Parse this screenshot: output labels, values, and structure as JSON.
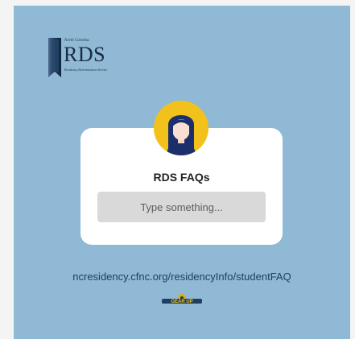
{
  "colors": {
    "background": "#8fb9d4",
    "card": "#ffffff",
    "input": "#d9d9d9",
    "avatar_circle": "#f2c11b",
    "url_text": "#1f3f61"
  },
  "logo": {
    "state": "North Carolina",
    "acronym": "RDS",
    "full_name": "Residency Determination Service"
  },
  "card": {
    "title": "RDS FAQs",
    "input_placeholder": "Type something...",
    "avatar_icon": "user-avatar-icon"
  },
  "url_text": "ncresidency.cfnc.org/residencyInfo/studentFAQ",
  "footer_logo": {
    "text": "GEAR UP",
    "icon": "gear-up-logo"
  }
}
